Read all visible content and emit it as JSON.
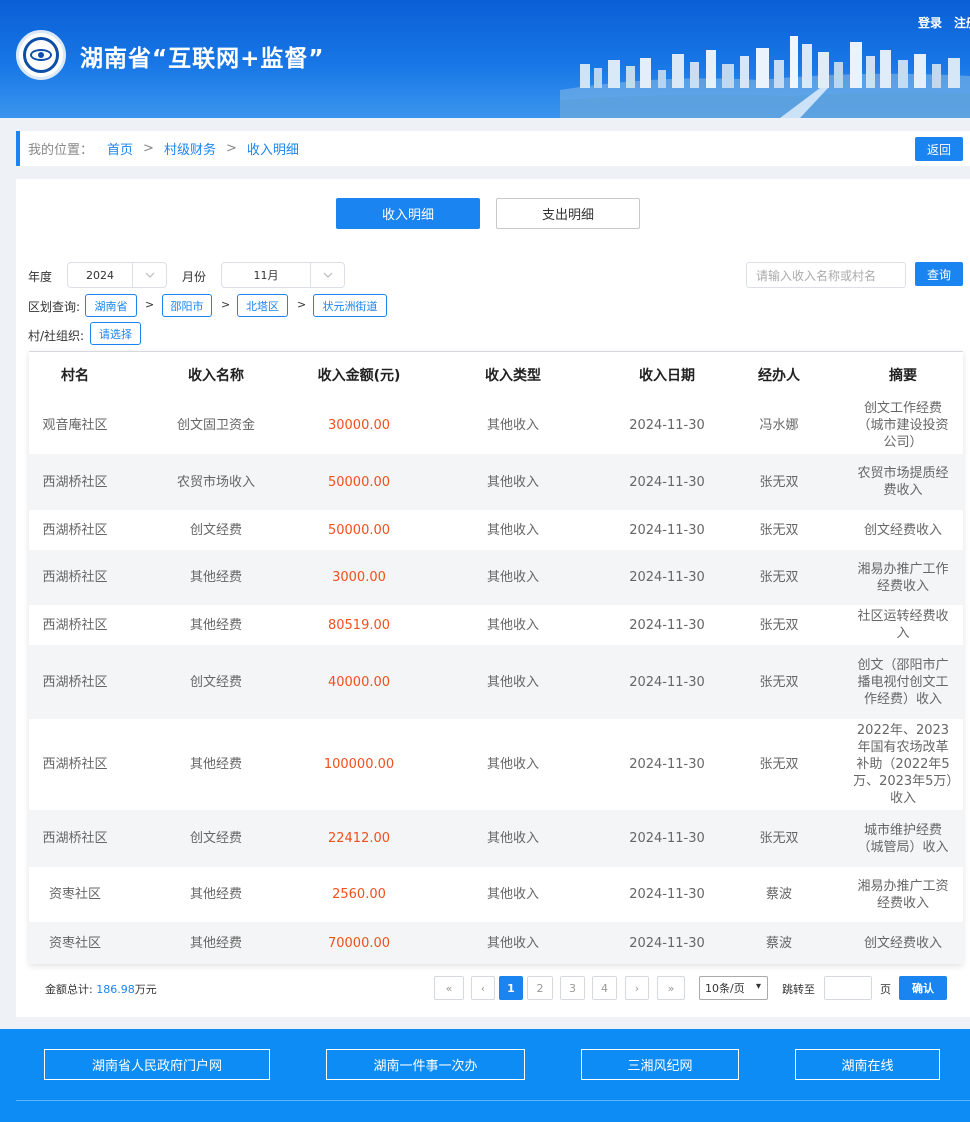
{
  "header": {
    "title": "湖南省“互联网+监督”",
    "login": "登录",
    "register": "注册"
  },
  "breadcrumb": {
    "label": "我的位置：",
    "items": [
      "首页",
      "村级财务",
      "收入明细"
    ],
    "separator": ">",
    "back": "返回"
  },
  "tabs": {
    "income": "收入明细",
    "expense": "支出明细"
  },
  "filters": {
    "year_label": "年度",
    "year_value": "2024",
    "month_label": "月份",
    "month_value": "11月",
    "search_placeholder": "请输入收入名称或村名",
    "query_button": "查询",
    "region_label": "区划查询:",
    "regions": [
      "湖南省",
      "邵阳市",
      "北塔区",
      "状元洲街道"
    ],
    "org_label": "村/社组织:",
    "org_button": "请选择"
  },
  "table": {
    "headers": [
      "村名",
      "收入名称",
      "收入金额(元)",
      "收入类型",
      "收入日期",
      "经办人",
      "摘要"
    ],
    "rows": [
      {
        "village": "观音庵社区",
        "name": "创文固卫资金",
        "amount": "30000.00",
        "type": "其他收入",
        "date": "2024-11-30",
        "handler": "冯水娜",
        "summary": "创文工作经费（城市建设投资公司）"
      },
      {
        "village": "西湖桥社区",
        "name": "农贸市场收入",
        "amount": "50000.00",
        "type": "其他收入",
        "date": "2024-11-30",
        "handler": "张无双",
        "summary": "农贸市场提质经费收入"
      },
      {
        "village": "西湖桥社区",
        "name": "创文经费",
        "amount": "50000.00",
        "type": "其他收入",
        "date": "2024-11-30",
        "handler": "张无双",
        "summary": "创文经费收入"
      },
      {
        "village": "西湖桥社区",
        "name": "其他经费",
        "amount": "3000.00",
        "type": "其他收入",
        "date": "2024-11-30",
        "handler": "张无双",
        "summary": "湘易办推广工作经费收入"
      },
      {
        "village": "西湖桥社区",
        "name": "其他经费",
        "amount": "80519.00",
        "type": "其他收入",
        "date": "2024-11-30",
        "handler": "张无双",
        "summary": "社区运转经费收入"
      },
      {
        "village": "西湖桥社区",
        "name": "创文经费",
        "amount": "40000.00",
        "type": "其他收入",
        "date": "2024-11-30",
        "handler": "张无双",
        "summary": "创文（邵阳市广播电视付创文工作经费）收入"
      },
      {
        "village": "西湖桥社区",
        "name": "其他经费",
        "amount": "100000.00",
        "type": "其他收入",
        "date": "2024-11-30",
        "handler": "张无双",
        "summary": "2022年、2023年国有农场改革补助（2022年5万、2023年5万）收入"
      },
      {
        "village": "西湖桥社区",
        "name": "创文经费",
        "amount": "22412.00",
        "type": "其他收入",
        "date": "2024-11-30",
        "handler": "张无双",
        "summary": "城市维护经费（城管局）收入"
      },
      {
        "village": "资枣社区",
        "name": "其他经费",
        "amount": "2560.00",
        "type": "其他收入",
        "date": "2024-11-30",
        "handler": "蔡波",
        "summary": "湘易办推广工资经费收入"
      },
      {
        "village": "资枣社区",
        "name": "其他经费",
        "amount": "70000.00",
        "type": "其他收入",
        "date": "2024-11-30",
        "handler": "蔡波",
        "summary": "创文经费收入"
      }
    ]
  },
  "pagination": {
    "total_label": "金额总计:",
    "total_value": "186.98",
    "total_unit": "万元",
    "first": "«",
    "prev": "‹",
    "pages": [
      "1",
      "2",
      "3",
      "4"
    ],
    "next": "›",
    "last": "»",
    "page_size": "10条/页",
    "jump_label": "跳转至",
    "page_unit": "页",
    "confirm": "确认"
  },
  "footer": {
    "links": [
      "湖南省人民政府门户网",
      "湖南一件事一次办",
      "三湘风纪网",
      "湖南在线"
    ]
  },
  "colors": {
    "primary": "#1a84f0",
    "amount": "#f0501a",
    "header_bg": "#0a5fd6",
    "footer_bg": "#0e8cf5"
  }
}
